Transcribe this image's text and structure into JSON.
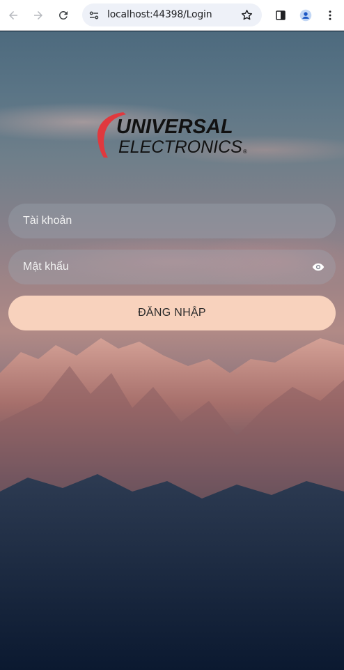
{
  "browser": {
    "url": "localhost:44398/Login"
  },
  "logo": {
    "line1": "UNIVERSAL",
    "line2": "ELECTRONICS",
    "mark": "®"
  },
  "form": {
    "username_placeholder": "Tài khoản",
    "password_placeholder": "Mật khẩu",
    "submit_label": "ĐĂNG NHẬP"
  },
  "colors": {
    "button_bg": "#f8d2bd",
    "logo_red": "#e0393e"
  },
  "icons": [
    "back-arrow-icon",
    "forward-arrow-icon",
    "reload-icon",
    "site-info-icon",
    "bookmark-star-icon",
    "side-panel-icon",
    "profile-avatar-icon",
    "kebab-menu-icon",
    "eye-icon"
  ]
}
